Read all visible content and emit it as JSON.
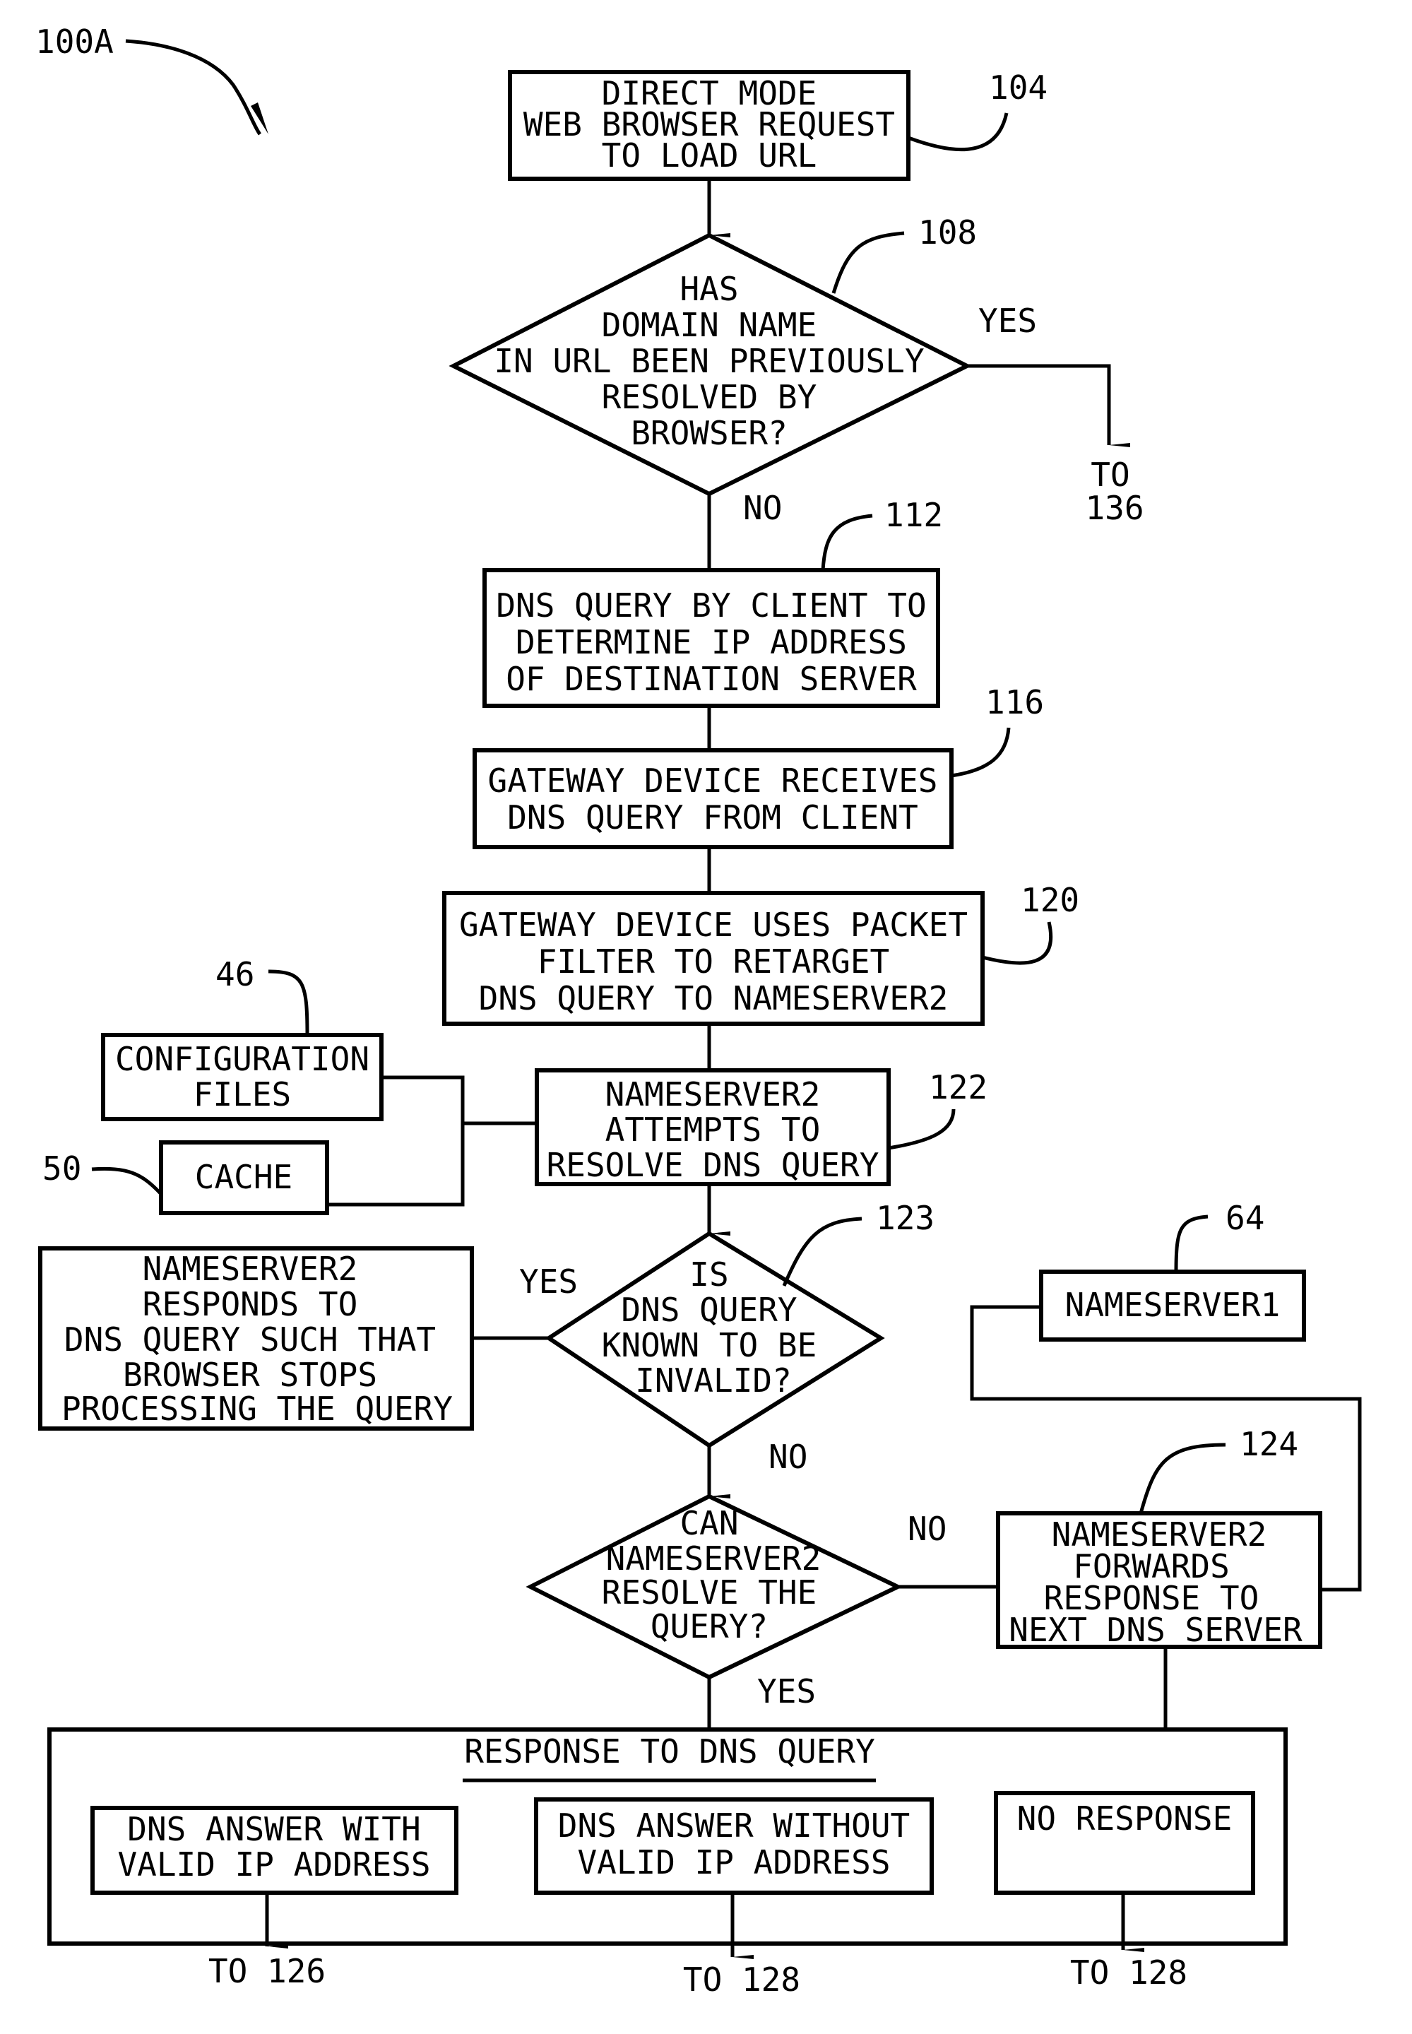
{
  "figure_label": "100A",
  "nodes": {
    "n104": {
      "ref": "104",
      "lines": [
        "DIRECT MODE",
        "WEB BROWSER REQUEST",
        "TO LOAD URL"
      ]
    },
    "n108": {
      "ref": "108",
      "lines": [
        "HAS",
        "DOMAIN NAME",
        "IN URL BEEN PREVIOUSLY",
        "RESOLVED BY",
        "BROWSER?"
      ],
      "yes": "YES",
      "no": "NO",
      "yes_target": [
        "TO",
        "136"
      ]
    },
    "n112": {
      "ref": "112",
      "lines": [
        "DNS QUERY BY CLIENT TO",
        "DETERMINE IP ADDRESS",
        "OF DESTINATION SERVER"
      ]
    },
    "n116": {
      "ref": "116",
      "lines": [
        "GATEWAY DEVICE RECEIVES",
        "DNS QUERY FROM CLIENT"
      ]
    },
    "n120": {
      "ref": "120",
      "lines": [
        "GATEWAY DEVICE USES PACKET",
        "FILTER TO RETARGET",
        "DNS QUERY TO NAMESERVER2"
      ]
    },
    "n46": {
      "ref": "46",
      "lines": [
        "CONFIGURATION",
        "FILES"
      ]
    },
    "n50": {
      "ref": "50",
      "lines": [
        "CACHE"
      ]
    },
    "n122": {
      "ref": "122",
      "lines": [
        "NAMESERVER2",
        "ATTEMPTS TO",
        "RESOLVE DNS QUERY"
      ]
    },
    "n123": {
      "ref": "123",
      "lines": [
        "IS",
        "DNS QUERY",
        "KNOWN TO BE",
        "INVALID?"
      ],
      "yes": "YES",
      "no": "NO"
    },
    "n_invalid": {
      "lines": [
        "NAMESERVER2",
        "RESPONDS TO",
        "DNS QUERY SUCH THAT",
        "BROWSER STOPS",
        "PROCESSING THE QUERY"
      ]
    },
    "n64": {
      "ref": "64",
      "lines": [
        "NAMESERVER1"
      ]
    },
    "n_can": {
      "lines": [
        "CAN",
        "NAMESERVER2",
        "RESOLVE THE",
        "QUERY?"
      ],
      "yes": "YES",
      "no": "NO"
    },
    "n124": {
      "ref": "124",
      "lines": [
        "NAMESERVER2",
        "FORWARDS",
        "RESPONSE TO",
        "NEXT DNS SERVER"
      ]
    },
    "response": {
      "title": "RESPONSE TO DNS QUERY",
      "options": [
        {
          "lines": [
            "DNS ANSWER WITH",
            "VALID IP ADDRESS"
          ],
          "target": "TO 126"
        },
        {
          "lines": [
            "DNS ANSWER WITHOUT",
            "VALID IP ADDRESS"
          ],
          "target": "TO 128"
        },
        {
          "lines": [
            "NO RESPONSE"
          ],
          "target": "TO 128"
        }
      ]
    }
  }
}
